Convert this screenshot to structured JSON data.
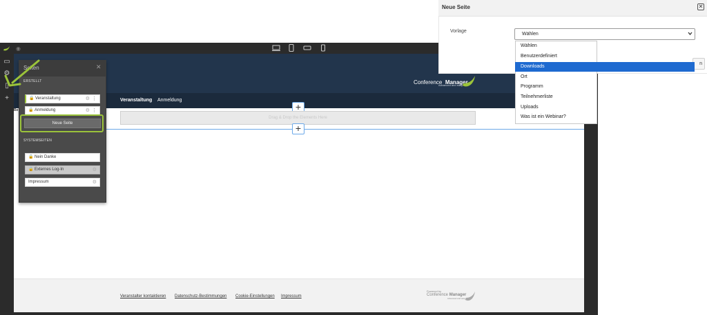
{
  "editor": {
    "devices": [
      "desktop",
      "tablet-portrait",
      "tablet-landscape",
      "phone"
    ]
  },
  "site": {
    "logo_word1": "Conference",
    "logo_word2": "Manager",
    "logo_tagline": "Advanced and easy",
    "nav": [
      "Veranstaltung",
      "Anmeldung"
    ],
    "drop_zone": "Drag & Drop the Elements Here",
    "partial_label": "Be",
    "footer_links": [
      "Veranstalter kontaktieren",
      "Datenschutz-Bestimmungen",
      "Cookie-Einstellungen",
      "Impressum"
    ],
    "powered_by": "Powered by",
    "powered_word1": "Conference",
    "powered_word2": "Manager",
    "powered_tagline": "Advanced and easy"
  },
  "pages_panel": {
    "title": "Seiten",
    "created_label": "ERSTELLT",
    "created_pages": [
      "Veranstaltung",
      "Anmeldung"
    ],
    "new_page_button": "Neue Seite",
    "system_label": "SYSTEMSEITEN",
    "system_pages": [
      "Nein Danke",
      "Externes Log-In",
      "Impressum"
    ]
  },
  "modal": {
    "title": "Neue Seite",
    "field_label": "Vorlage",
    "select_value": "Wählen",
    "button_peek": "n",
    "options": [
      "Wählen",
      "Benutzerdefiniert",
      "Downloads",
      "Ort",
      "Programm",
      "Teilnehmerliste",
      "Uploads",
      "Was ist ein Webinar?"
    ],
    "selected_option": "Downloads"
  },
  "colors": {
    "accent_green": "#9bc33a",
    "header_navy": "#22354c",
    "selection_blue": "#1e6ad0"
  }
}
